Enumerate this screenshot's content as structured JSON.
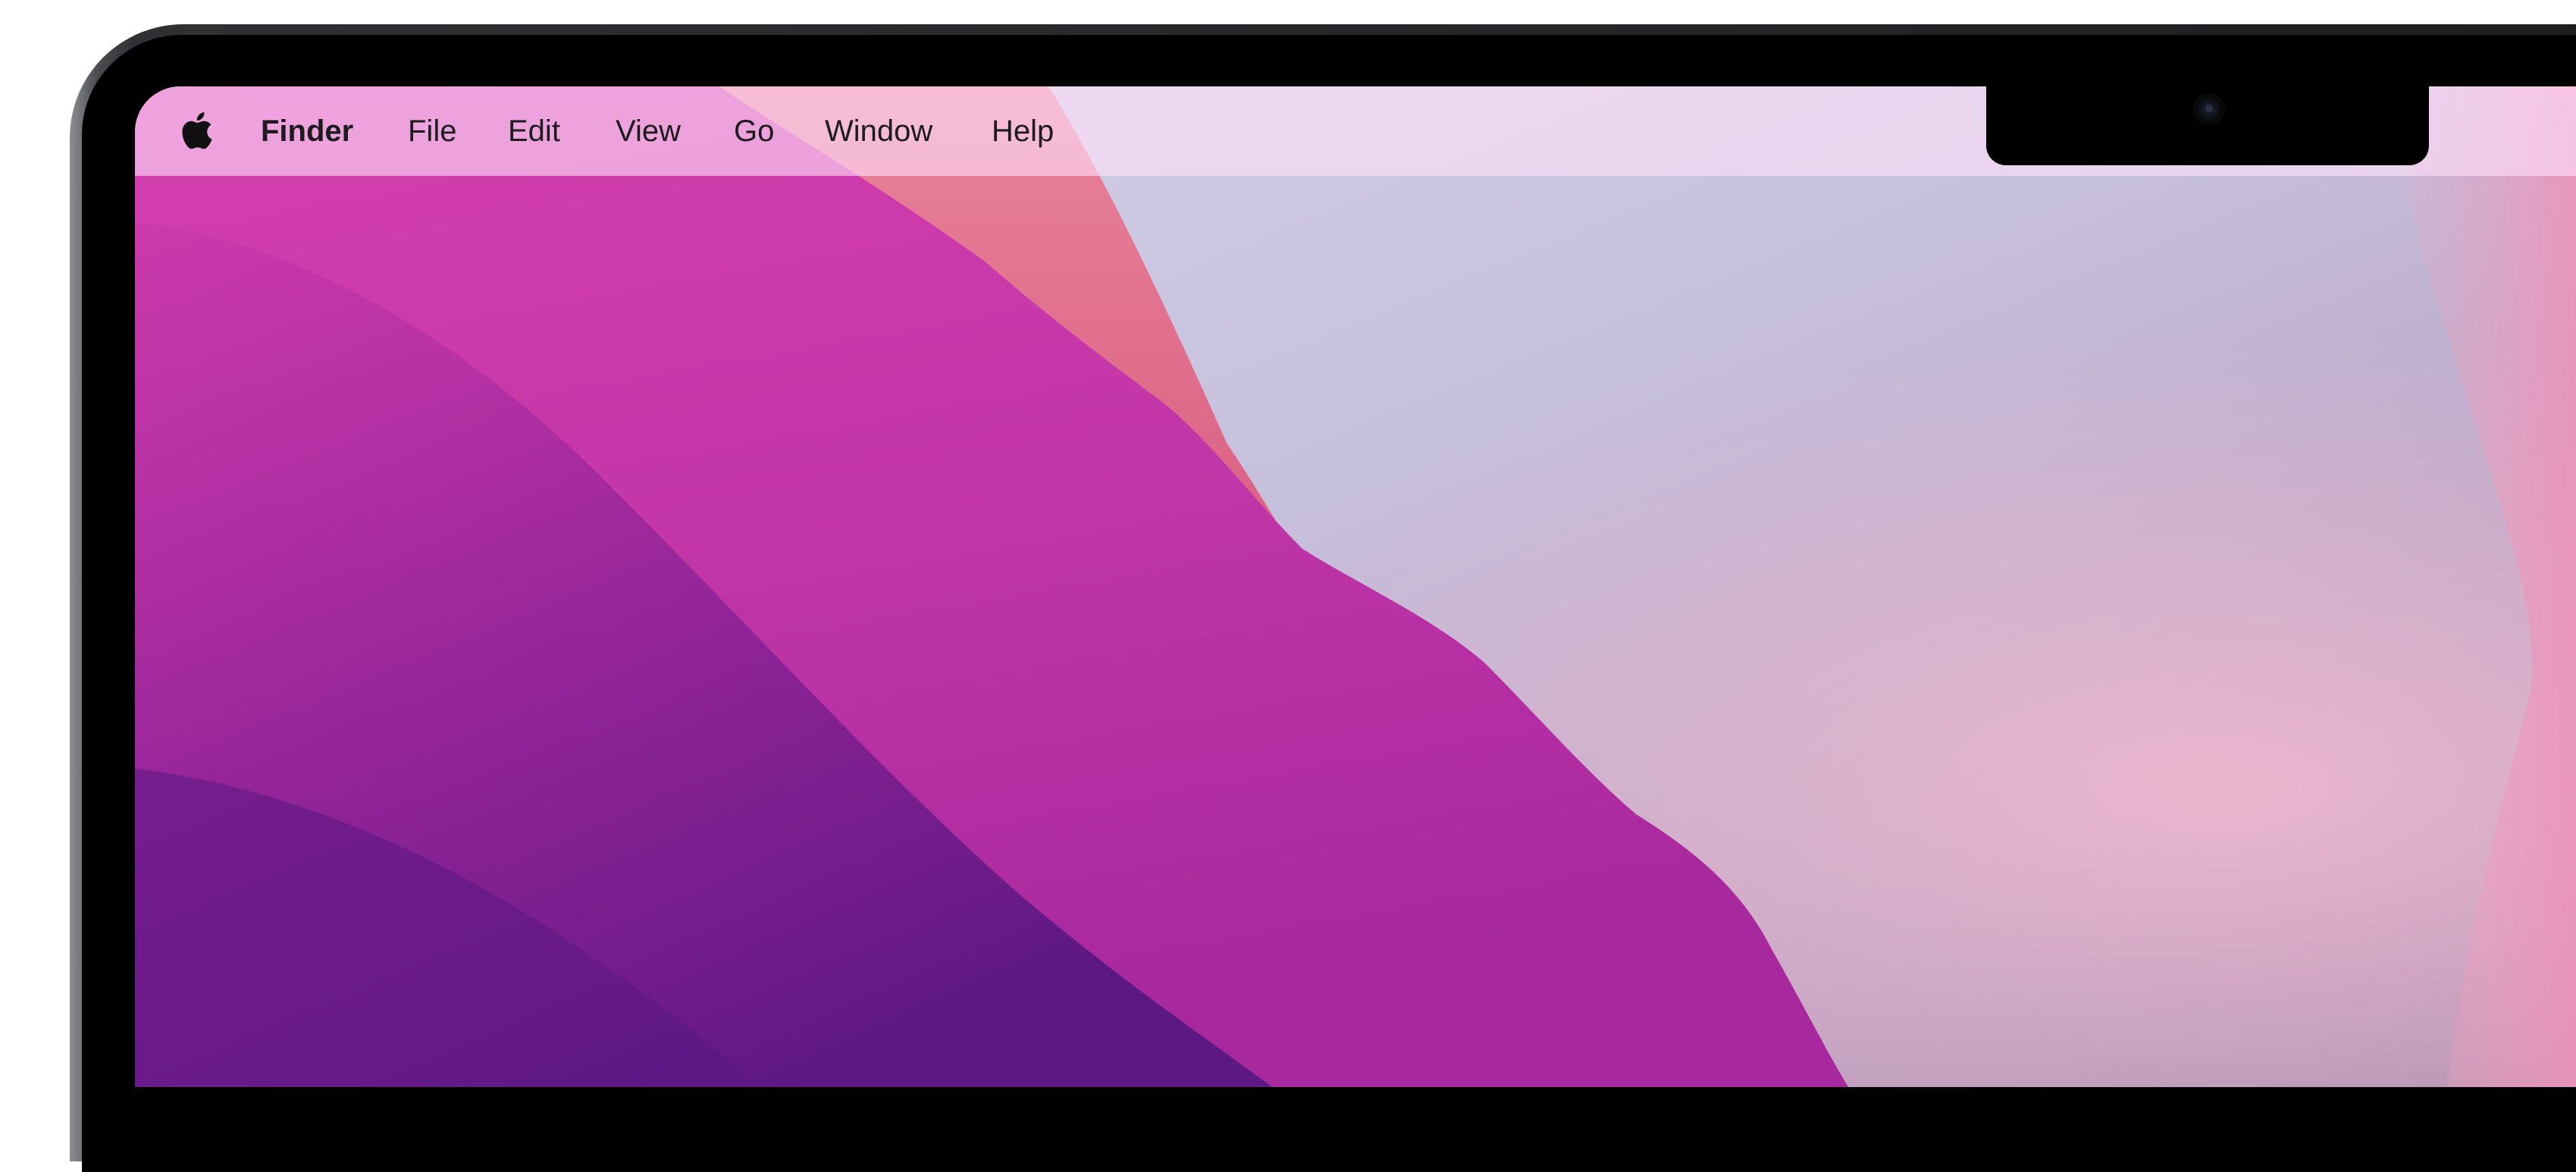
{
  "menubar": {
    "apple_icon": "apple-logo-icon",
    "app_name": "Finder",
    "items": [
      "File",
      "Edit",
      "View",
      "Go",
      "Window",
      "Help"
    ]
  },
  "colors": {
    "menubar_background": "#f2c6ef",
    "menu_text": "#1c1c1e",
    "wallpaper_magenta": "#c933b0",
    "wallpaper_purple": "#6b1d8e",
    "wallpaper_coral": "#e3738b",
    "wallpaper_lavender": "#c9c8e2"
  }
}
